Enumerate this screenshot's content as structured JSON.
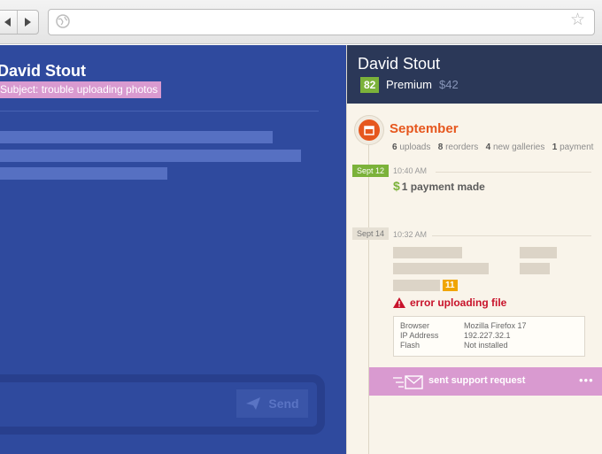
{
  "browser": {
    "url": ""
  },
  "chat": {
    "customer_name": "David Stout",
    "subject": "Subject: trouble uploading photos",
    "send_label": "Send"
  },
  "profile": {
    "name": "David Stout",
    "score": "82",
    "tier": "Premium",
    "amount": "$42",
    "month": "September",
    "stats": [
      {
        "count": "6",
        "label": "uploads"
      },
      {
        "count": "8",
        "label": "reorders"
      },
      {
        "count": "4",
        "label": "new galleries"
      },
      {
        "count": "1",
        "label": "payment"
      }
    ],
    "events": [
      {
        "date": "Sept 12",
        "time": "10:40 AM",
        "title": "1 payment made"
      },
      {
        "date": "Sept 14",
        "time": "10:32 AM",
        "badge": "11",
        "error": "error uploading file",
        "details": [
          {
            "key": "Browser",
            "value": "Mozilla Firefox 17"
          },
          {
            "key": "IP Address",
            "value": "192.227.32.1"
          },
          {
            "key": "Flash",
            "value": "Not installed"
          }
        ]
      }
    ],
    "support_label": "sent support request",
    "more_label": "•••"
  },
  "colors": {
    "chat_bg": "#2f4a9e",
    "header_bg": "#2b3858",
    "accent_orange": "#e6571e",
    "accent_green": "#7bb23a",
    "accent_pink": "#d99ad0",
    "error_red": "#c8132b"
  },
  "icons": [
    "back-icon",
    "forward-icon",
    "globe-icon",
    "star-icon",
    "calendar-icon",
    "dollar-icon",
    "warning-icon",
    "envelope-icon",
    "send-icon",
    "more-icon"
  ]
}
